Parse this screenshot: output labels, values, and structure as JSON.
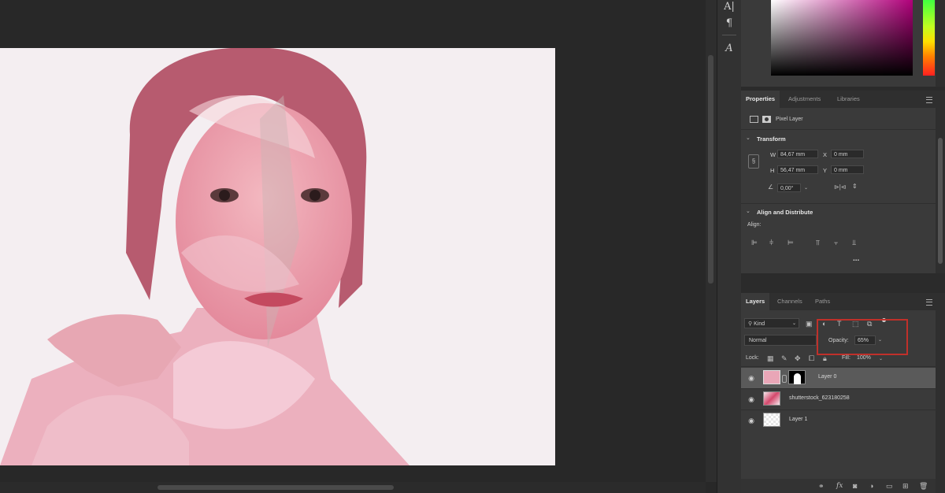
{
  "toolstrip": {
    "icons": [
      "character-panel-icon",
      "paragraph-panel-icon",
      "glyphs-icon"
    ]
  },
  "properties": {
    "tabs": [
      "Properties",
      "Adjustments",
      "Libraries"
    ],
    "layer_kind": "Pixel Layer",
    "transform": {
      "title": "Transform",
      "w_label": "W",
      "w_value": "84,67 mm",
      "h_label": "H",
      "h_value": "56,47 mm",
      "x_label": "X",
      "x_value": "0 mm",
      "y_label": "Y",
      "y_value": "0 mm",
      "angle_value": "0,00°"
    },
    "align": {
      "title": "Align and Distribute",
      "align_label": "Align:",
      "more": "..."
    }
  },
  "layers": {
    "tabs": [
      "Layers",
      "Channels",
      "Paths"
    ],
    "filter_kind": "Kind",
    "blend_mode": "Normal",
    "opacity_label": "Opacity:",
    "opacity_value": "65%",
    "lock_label": "Lock:",
    "fill_label": "Fill:",
    "fill_value": "100%",
    "items": [
      {
        "name": "Layer 0",
        "selected": true,
        "has_mask": true
      },
      {
        "name": "shutterstock_623180258",
        "selected": false,
        "has_mask": false
      },
      {
        "name": "Layer 1",
        "selected": false,
        "has_mask": false
      }
    ],
    "bottom_icons": [
      "link-layers-icon",
      "fx-icon",
      "add-mask-icon",
      "adjustment-layer-icon",
      "new-group-icon",
      "new-layer-icon",
      "delete-layer-icon"
    ],
    "bottom_fx": "fx"
  },
  "colors": {
    "highlight_box": "#c0302a",
    "selected_layer": "#5a5a5a",
    "panel_bg": "#3a3a3a"
  }
}
